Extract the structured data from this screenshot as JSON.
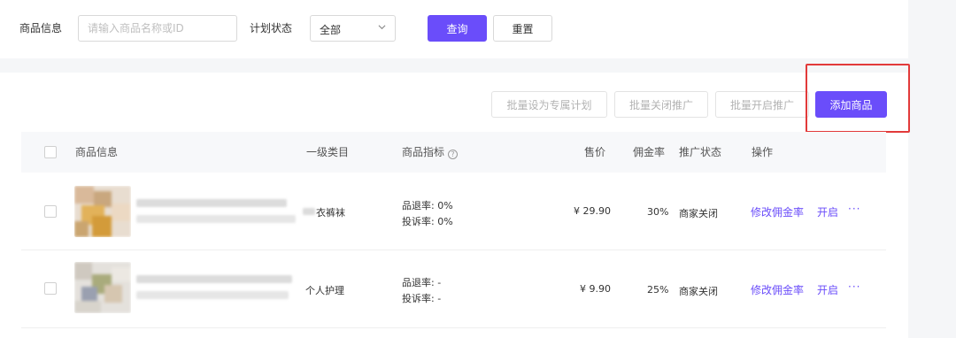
{
  "filters": {
    "product_info_label": "商品信息",
    "search_placeholder": "请输入商品名称或ID",
    "plan_status_label": "计划状态",
    "plan_status_value": "全部",
    "query_button": "查询",
    "reset_button": "重置"
  },
  "toolbar": {
    "batch_exclusive": "批量设为专属计划",
    "batch_close": "批量关闭推广",
    "batch_open": "批量开启推广",
    "add_product": "添加商品"
  },
  "table": {
    "columns": [
      "商品信息",
      "一级类目",
      "商品指标",
      "售价",
      "佣金率",
      "推广状态",
      "操作"
    ],
    "rows": [
      {
        "category": "衣裤袜",
        "return_rate": "品退率: 0%",
        "complaint_rate": "投诉率: 0%",
        "price": "¥ 29.90",
        "commission": "30%",
        "status": "商家关闭",
        "action_edit": "修改佣金率",
        "action_open": "开启",
        "action_more": "···"
      },
      {
        "category": "个人护理",
        "return_rate": "品退率: -",
        "complaint_rate": "投诉率: -",
        "price": "¥ 9.90",
        "commission": "25%",
        "status": "商家关闭",
        "action_edit": "修改佣金率",
        "action_open": "开启",
        "action_more": "···"
      }
    ]
  },
  "colors": {
    "accent": "#6a4dfa",
    "highlight": "#e23a3a"
  }
}
